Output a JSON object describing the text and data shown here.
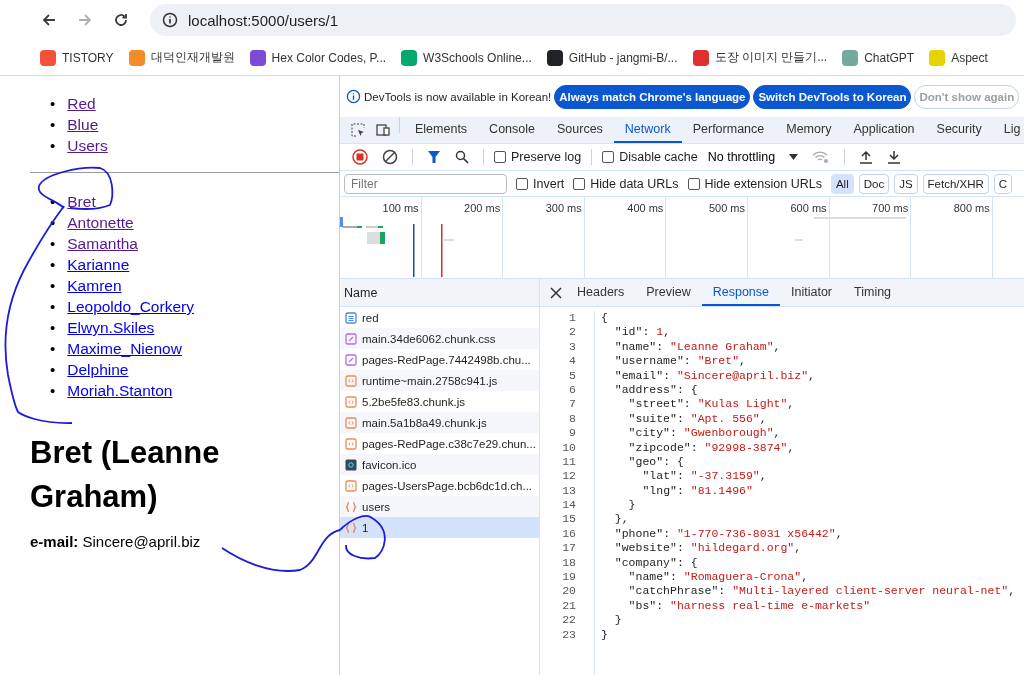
{
  "browser": {
    "url": "localhost:5000/users/1",
    "bookmarks": [
      {
        "label": "TISTORY",
        "color": "#f4503c"
      },
      {
        "label": "대덕인재개발원",
        "color": "#f28c28"
      },
      {
        "label": "Hex Color Codes, P...",
        "color": "#7b4bd6"
      },
      {
        "label": "W3Schools Online...",
        "color": "#04aa6d"
      },
      {
        "label": "GitHub - jangmi-B/...",
        "color": "#1f2328"
      },
      {
        "label": "도장 이미지 만들기...",
        "color": "#e0302e"
      },
      {
        "label": "ChatGPT",
        "color": "#74aa9c"
      },
      {
        "label": "Aspect",
        "color": "#e8d200"
      }
    ]
  },
  "page": {
    "marker": "•",
    "nav_links": [
      {
        "label": "Red",
        "visited": true
      },
      {
        "label": "Blue",
        "visited": true
      },
      {
        "label": "Users",
        "visited": true
      }
    ],
    "user_links": [
      {
        "label": "Bret",
        "visited": true
      },
      {
        "label": "Antonette",
        "visited": true
      },
      {
        "label": "Samantha",
        "visited": true
      },
      {
        "label": "Karianne",
        "visited": false
      },
      {
        "label": "Kamren",
        "visited": false
      },
      {
        "label": "Leopoldo_Corkery",
        "visited": false
      },
      {
        "label": "Elwyn.Skiles",
        "visited": false
      },
      {
        "label": "Maxime_Nienow",
        "visited": false
      },
      {
        "label": "Delphine",
        "visited": false
      },
      {
        "label": "Moriah.Stanton",
        "visited": false
      }
    ],
    "heading": "Bret (Leanne Graham)",
    "email_label": "e-mail:",
    "email": "Sincere@april.biz"
  },
  "devtools": {
    "infobar": {
      "message": "DevTools is now available in Korean!",
      "buttons": [
        {
          "label": "Always match Chrome's language",
          "kind": "primary"
        },
        {
          "label": "Switch DevTools to Korean",
          "kind": "primary"
        },
        {
          "label": "Don't show again",
          "kind": "outline"
        }
      ]
    },
    "tabs": [
      {
        "label": "Elements",
        "selected": false
      },
      {
        "label": "Console",
        "selected": false
      },
      {
        "label": "Sources",
        "selected": false
      },
      {
        "label": "Network",
        "selected": true
      },
      {
        "label": "Performance",
        "selected": false
      },
      {
        "label": "Memory",
        "selected": false
      },
      {
        "label": "Application",
        "selected": false
      },
      {
        "label": "Security",
        "selected": false
      },
      {
        "label": "Lig",
        "selected": false
      }
    ],
    "toolbar": {
      "recording": true,
      "preserve_log": {
        "label": "Preserve log",
        "checked": false
      },
      "disable_cache": {
        "label": "Disable cache",
        "checked": false
      },
      "throttling": "No throttling"
    },
    "filter": {
      "placeholder": "Filter",
      "options": [
        {
          "label": "Invert",
          "checked": false
        },
        {
          "label": "Hide data URLs",
          "checked": false
        },
        {
          "label": "Hide extension URLs",
          "checked": false
        }
      ],
      "types": [
        {
          "label": "All",
          "selected": true
        },
        {
          "label": "Doc",
          "selected": false
        },
        {
          "label": "JS",
          "selected": false
        },
        {
          "label": "Fetch/XHR",
          "selected": false
        },
        {
          "label": "C",
          "selected": false
        }
      ]
    },
    "timeline_ticks": [
      "100 ms",
      "200 ms",
      "300 ms",
      "400 ms",
      "500 ms",
      "600 ms",
      "700 ms",
      "800 ms"
    ],
    "name_header": "Name",
    "requests": [
      {
        "name": "red",
        "kind": "doc",
        "selected": false
      },
      {
        "name": "main.34de6062.chunk.css",
        "kind": "css",
        "selected": false
      },
      {
        "name": "pages-RedPage.7442498b.chu...",
        "kind": "css",
        "selected": false
      },
      {
        "name": "runtime~main.2758c941.js",
        "kind": "js",
        "selected": false
      },
      {
        "name": "5.2be5fe83.chunk.js",
        "kind": "js",
        "selected": false
      },
      {
        "name": "main.5a1b8a49.chunk.js",
        "kind": "js",
        "selected": false
      },
      {
        "name": "pages-RedPage.c38c7e29.chun...",
        "kind": "js",
        "selected": false
      },
      {
        "name": "favicon.ico",
        "kind": "ico",
        "selected": false
      },
      {
        "name": "pages-UsersPage.bcb6dc1d.ch...",
        "kind": "js",
        "selected": false
      },
      {
        "name": "users",
        "kind": "fetch",
        "selected": false
      },
      {
        "name": "1",
        "kind": "fetch",
        "selected": true
      }
    ],
    "detail_tabs": [
      {
        "label": "Headers",
        "selected": false
      },
      {
        "label": "Preview",
        "selected": false
      },
      {
        "label": "Response",
        "selected": true
      },
      {
        "label": "Initiator",
        "selected": false
      },
      {
        "label": "Timing",
        "selected": false
      }
    ],
    "response_lines": [
      {
        "number": "1",
        "text": "{"
      },
      {
        "number": "2",
        "text": "  \"id\": 1,"
      },
      {
        "number": "3",
        "text": "  \"name\": \"Leanne Graham\","
      },
      {
        "number": "4",
        "text": "  \"username\": \"Bret\","
      },
      {
        "number": "5",
        "text": "  \"email\": \"Sincere@april.biz\","
      },
      {
        "number": "6",
        "text": "  \"address\": {"
      },
      {
        "number": "7",
        "text": "    \"street\": \"Kulas Light\","
      },
      {
        "number": "8",
        "text": "    \"suite\": \"Apt. 556\","
      },
      {
        "number": "9",
        "text": "    \"city\": \"Gwenborough\","
      },
      {
        "number": "10",
        "text": "    \"zipcode\": \"92998-3874\","
      },
      {
        "number": "11",
        "text": "    \"geo\": {"
      },
      {
        "number": "12",
        "text": "      \"lat\": \"-37.3159\","
      },
      {
        "number": "13",
        "text": "      \"lng\": \"81.1496\""
      },
      {
        "number": "14",
        "text": "    }"
      },
      {
        "number": "15",
        "text": "  },"
      },
      {
        "number": "16",
        "text": "  \"phone\": \"1-770-736-8031 x56442\","
      },
      {
        "number": "17",
        "text": "  \"website\": \"hildegard.org\","
      },
      {
        "number": "18",
        "text": "  \"company\": {"
      },
      {
        "number": "19",
        "text": "    \"name\": \"Romaguera-Crona\","
      },
      {
        "number": "20",
        "text": "    \"catchPhrase\": \"Multi-layered client-server neural-net\","
      },
      {
        "number": "21",
        "text": "    \"bs\": \"harness real-time e-markets\""
      },
      {
        "number": "22",
        "text": "  }"
      },
      {
        "number": "23",
        "text": "}"
      }
    ]
  }
}
